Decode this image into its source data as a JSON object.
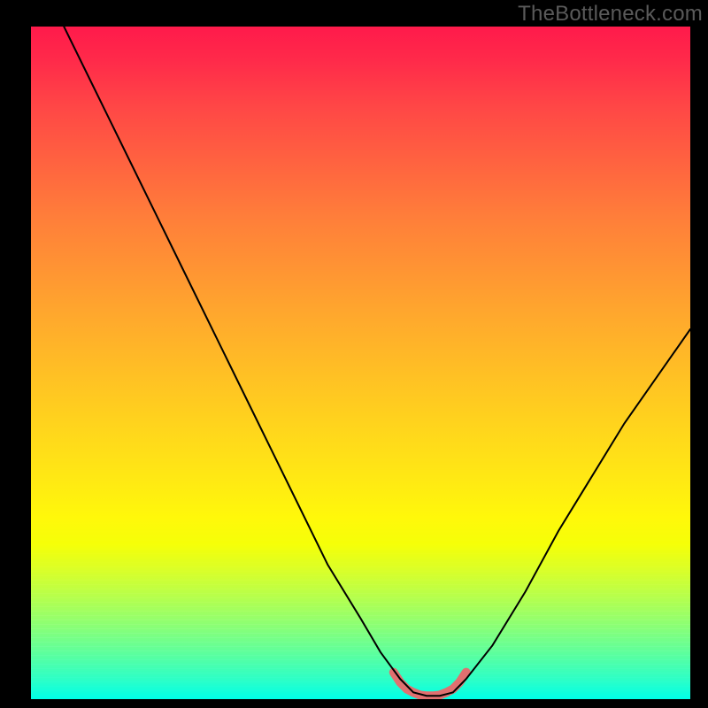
{
  "watermark": "TheBottleneck.com",
  "chart_data": {
    "type": "line",
    "title": "",
    "xlabel": "",
    "ylabel": "",
    "xlim": [
      0,
      100
    ],
    "ylim": [
      0,
      100
    ],
    "grid": false,
    "series": [
      {
        "name": "bottleneck-curve",
        "x": [
          5,
          10,
          15,
          20,
          25,
          30,
          35,
          40,
          45,
          50,
          53,
          56,
          58,
          60,
          62,
          64,
          66,
          70,
          75,
          80,
          85,
          90,
          95,
          100
        ],
        "y": [
          100,
          90,
          80,
          70,
          60,
          50,
          40,
          30,
          20,
          12,
          7,
          3,
          1,
          0.5,
          0.5,
          1,
          3,
          8,
          16,
          25,
          33,
          41,
          48,
          55
        ],
        "stroke": "#000000",
        "stroke_width": 2
      },
      {
        "name": "optimal-band",
        "x": [
          55,
          56,
          57,
          58,
          59,
          60,
          61,
          62,
          63,
          64,
          65,
          66
        ],
        "y": [
          4,
          2.5,
          1.5,
          1,
          0.6,
          0.5,
          0.5,
          0.6,
          1,
          1.5,
          2.5,
          4
        ],
        "stroke": "#e07070",
        "stroke_width": 10
      }
    ],
    "background_gradient": {
      "top_color": "#ff1a4b",
      "mid_color": "#ffe000",
      "bottom_color": "#00ffcc"
    }
  }
}
